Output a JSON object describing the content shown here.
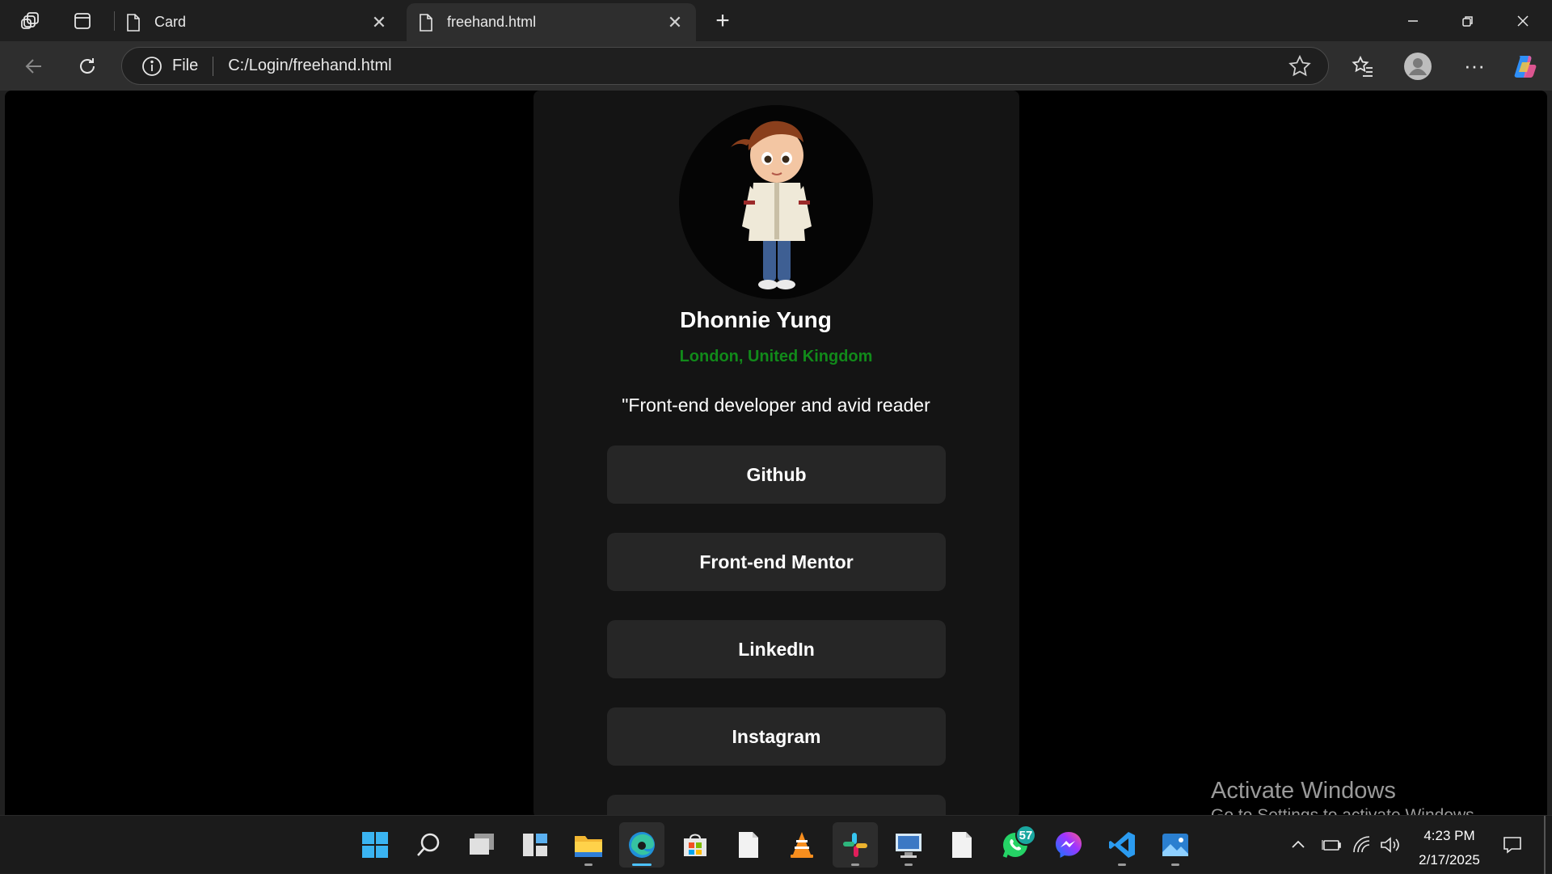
{
  "browser": {
    "tabs": [
      {
        "title": "Card"
      },
      {
        "title": "freehand.html"
      }
    ],
    "address": {
      "scheme_label": "File",
      "url": "C:/Login/freehand.html"
    }
  },
  "card": {
    "name": "Dhonnie Yung",
    "location": "London, United Kingdom",
    "bio": "\"Front-end developer and avid reader",
    "links": [
      {
        "label": "Github"
      },
      {
        "label": "Front-end Mentor"
      },
      {
        "label": "LinkedIn"
      },
      {
        "label": "Instagram"
      }
    ]
  },
  "watermark": {
    "title": "Activate Windows",
    "subtitle": "Go to Settings to activate Windows."
  },
  "taskbar": {
    "whatsapp_badge": "57",
    "time": "4:23 PM",
    "date": "2/17/2025"
  },
  "colors": {
    "location_green": "#118a1a",
    "card_bg": "#141414",
    "button_bg": "#262626",
    "edge_accent": "#4cc2ff"
  }
}
